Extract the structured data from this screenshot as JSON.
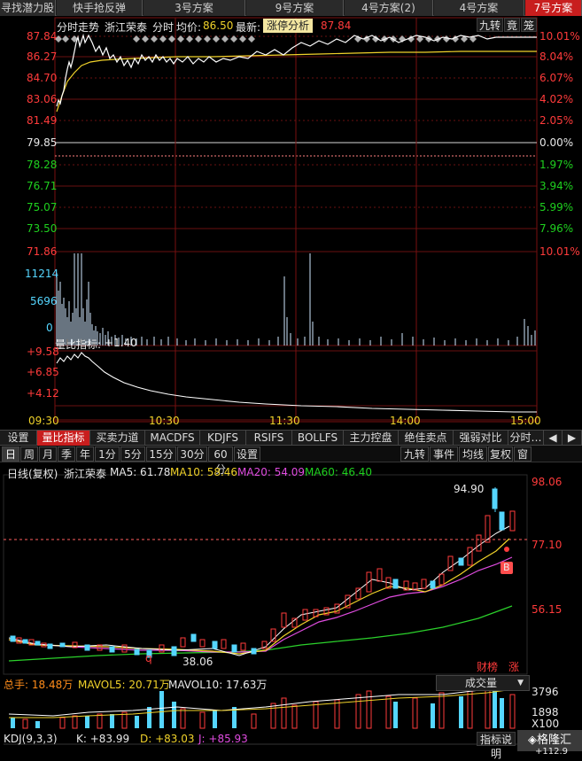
{
  "top_tabs": [
    "寻找潜力股",
    "快手抢反弹",
    "3号方案",
    "9号方案",
    "4号方案(2)",
    "4号方案",
    "7号方案"
  ],
  "intraday": {
    "title": "分时走势",
    "stock_name": "浙江荣泰",
    "mode": "分时",
    "avg_label": "均价:",
    "avg_value": "86.50",
    "latest_label": "最新:",
    "latest_value": "87.84",
    "analysis_button": "涨停分析",
    "right_buttons": [
      "九转",
      "竟",
      "笼"
    ],
    "price_levels": [
      "87.84",
      "86.27",
      "84.70",
      "83.06",
      "81.49",
      "79.85",
      "78.28",
      "76.71",
      "75.07",
      "73.50",
      "71.86"
    ],
    "pct_levels": [
      "10.01%",
      "8.04%",
      "6.07%",
      "4.02%",
      "2.05%",
      "0.00%",
      "1.97%",
      "3.94%",
      "5.99%",
      "7.96%",
      "10.01%"
    ],
    "vol_levels": [
      "11214",
      "5696",
      "0"
    ],
    "ratio_label": "量比指标:",
    "ratio_value": "+1.40",
    "ratio_levels": [
      "+9.58",
      "+6.85",
      "+4.12"
    ],
    "time_labels": [
      "09:30",
      "10:30",
      "11:30",
      "14:00",
      "15:00"
    ]
  },
  "indicator_tabs": [
    "设置",
    "量比指标",
    "买卖力道",
    "MACDFS",
    "KDJFS",
    "RSIFS",
    "BOLLFS",
    "主力控盘",
    "绝佳卖点",
    "强弱对比",
    "分时…"
  ],
  "period_tabs": [
    "日",
    "周",
    "月",
    "季",
    "年",
    "1分",
    "5分",
    "15分",
    "30分",
    "60分",
    "设置"
  ],
  "period_right": [
    "九转",
    "事件",
    "均线",
    "复权",
    "窗"
  ],
  "daily": {
    "title": "日线(复权)",
    "stock_name": "浙江荣泰",
    "ma5": "MA5: 61.78",
    "ma10": "MA10: 58.46",
    "ma20": "MA20: 54.09",
    "ma60": "MA60: 46.40",
    "price_levels": [
      "98.06",
      "77.10",
      "56.15"
    ],
    "high_mark": "94.90",
    "low_mark": "38.06",
    "b_mark": "B",
    "q_mark": "q",
    "bottom_tags": [
      "财榜",
      "涨"
    ]
  },
  "volume_panel": {
    "total": "总手: 18.48万",
    "mavol5": "MAVOL5: 20.71万",
    "mavol10": "MAVOL10: 17.63万",
    "select": "成交量",
    "levels": [
      "3796",
      "1898",
      "X100"
    ]
  },
  "kdj": {
    "label": "KDJ(9,3,3)",
    "k": "K: +83.99",
    "d": "D: +83.03",
    "j": "J: +85.93",
    "button": "指标说明",
    "logo": "格隆汇",
    "level": "+112.9"
  },
  "colors": {
    "up": "#ff3b3b",
    "down": "#1fd11f",
    "accent": "#c81e1e",
    "price_line": "#ffffff",
    "avg_line": "#f0d22a"
  }
}
